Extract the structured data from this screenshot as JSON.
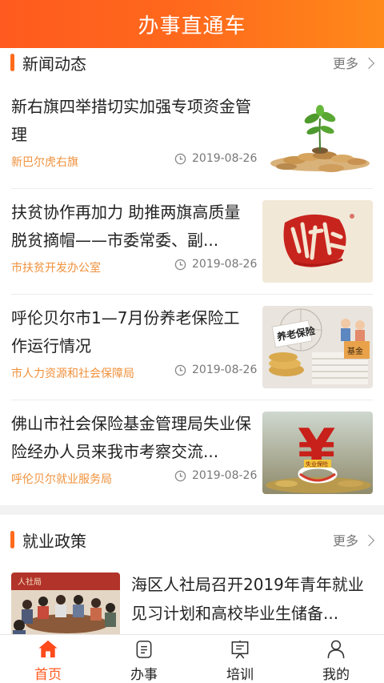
{
  "header": {
    "title": "办事直通车"
  },
  "news_section": {
    "title": "新闻动态",
    "more": "更多"
  },
  "news": [
    {
      "title": "新右旗四举措切实加强专项资金管理",
      "source": "新巴尔虎右旗",
      "date": "2019-08-26",
      "thumb": "coins-plant-image"
    },
    {
      "title": "扶贫协作再加力 助推两旗高质量脱贫摘帽——市委常委、副...",
      "source": "市扶贫开发办公室",
      "date": "2019-08-26",
      "thumb": "poverty-relief-calligraphy-image"
    },
    {
      "title": "呼伦贝尔市1—7月份养老保险工作运行情况",
      "source": "市人力资源和社会保障局",
      "date": "2019-08-26",
      "thumb": "pension-fund-image"
    },
    {
      "title": "佛山市社会保险基金管理局失业保险经办人员来我市考察交流...",
      "source": "呼伦贝尔就业服务局",
      "date": "2019-08-26",
      "thumb": "unemployment-insurance-image"
    }
  ],
  "policy_section": {
    "title": "就业政策",
    "more": "更多"
  },
  "policy": [
    {
      "title": "海区人社局召开2019年青年就业见习计划和高校毕业生储备...",
      "thumb": "meeting-photo"
    }
  ],
  "policy_thumb_text": "人社局",
  "thumb_text": {
    "pension_sign": "养老保险",
    "fund_box": "基金",
    "yuan": "¥",
    "unemployment_ribbon": "失业保险"
  },
  "tabs": [
    {
      "label": "首页",
      "icon": "home-icon",
      "active": true
    },
    {
      "label": "办事",
      "icon": "document-icon",
      "active": false
    },
    {
      "label": "培训",
      "icon": "training-board-icon",
      "active": false
    },
    {
      "label": "我的",
      "icon": "user-icon",
      "active": false
    }
  ],
  "colors": {
    "accent": "#ff5a1f",
    "source_text": "#f0913c"
  }
}
